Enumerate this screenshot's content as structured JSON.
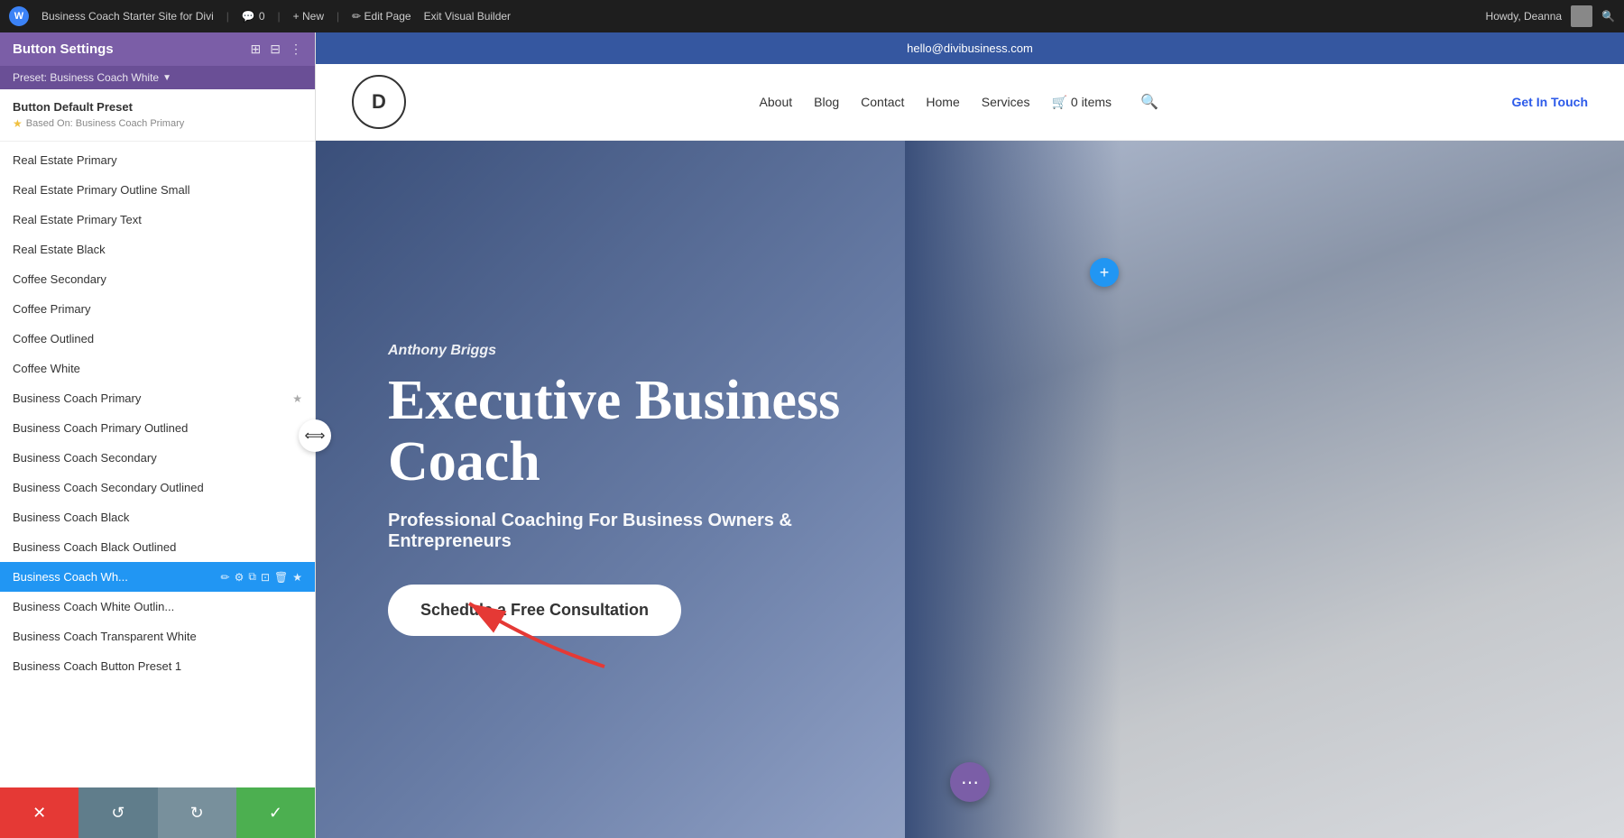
{
  "admin_bar": {
    "wp_label": "W",
    "site_name": "Business Coach Starter Site for Divi",
    "comment_icon": "💬",
    "comment_count": "0",
    "new_label": "+ New",
    "edit_label": "✏ Edit Page",
    "exit_label": "Exit Visual Builder",
    "howdy_label": "Howdy, Deanna",
    "search_icon": "🔍"
  },
  "panel": {
    "title": "Button Settings",
    "preset_label": "Preset: Business Coach White",
    "default_preset_label": "Button Default Preset",
    "based_on_label": "Based On: Business Coach Primary",
    "items": [
      {
        "id": 1,
        "label": "Real Estate Primary",
        "active": false,
        "starred": false
      },
      {
        "id": 2,
        "label": "Real Estate Primary Outline Small",
        "active": false,
        "starred": false
      },
      {
        "id": 3,
        "label": "Real Estate Primary Text",
        "active": false,
        "starred": false
      },
      {
        "id": 4,
        "label": "Real Estate Black",
        "active": false,
        "starred": false
      },
      {
        "id": 5,
        "label": "Coffee Secondary",
        "active": false,
        "starred": false
      },
      {
        "id": 6,
        "label": "Coffee Primary",
        "active": false,
        "starred": false
      },
      {
        "id": 7,
        "label": "Coffee Outlined",
        "active": false,
        "starred": false
      },
      {
        "id": 8,
        "label": "Coffee White",
        "active": false,
        "starred": false
      },
      {
        "id": 9,
        "label": "Business Coach Primary",
        "active": false,
        "starred": true
      },
      {
        "id": 10,
        "label": "Business Coach Primary Outlined",
        "active": false,
        "starred": false
      },
      {
        "id": 11,
        "label": "Business Coach Secondary",
        "active": false,
        "starred": false
      },
      {
        "id": 12,
        "label": "Business Coach Secondary Outlined",
        "active": false,
        "starred": false
      },
      {
        "id": 13,
        "label": "Business Coach Black",
        "active": false,
        "starred": false
      },
      {
        "id": 14,
        "label": "Business Coach Black Outlined",
        "active": false,
        "starred": false
      },
      {
        "id": 15,
        "label": "Business Coach Wh...",
        "active": true,
        "starred": true
      },
      {
        "id": 16,
        "label": "Business Coach White Outlin...",
        "active": false,
        "starred": false
      },
      {
        "id": 17,
        "label": "Business Coach Transparent White",
        "active": false,
        "starred": false
      },
      {
        "id": 18,
        "label": "Business Coach Button Preset 1",
        "active": false,
        "starred": false
      }
    ]
  },
  "bottom_toolbar": {
    "cancel_icon": "✕",
    "undo_icon": "↺",
    "redo_icon": "↻",
    "confirm_icon": "✓"
  },
  "site": {
    "topbar_email": "hello@divibusiness.com",
    "logo_letter": "D",
    "nav_links": [
      "About",
      "Blog",
      "Contact",
      "Home",
      "Services"
    ],
    "cart_label": "0 items",
    "cta_nav": "Get In Touch",
    "author_name": "Anthony Briggs",
    "hero_title": "Executive Business Coach",
    "hero_subtitle": "Professional Coaching For Business Owners & Entrepreneurs",
    "cta_button": "Schedule a Free Consultation"
  }
}
